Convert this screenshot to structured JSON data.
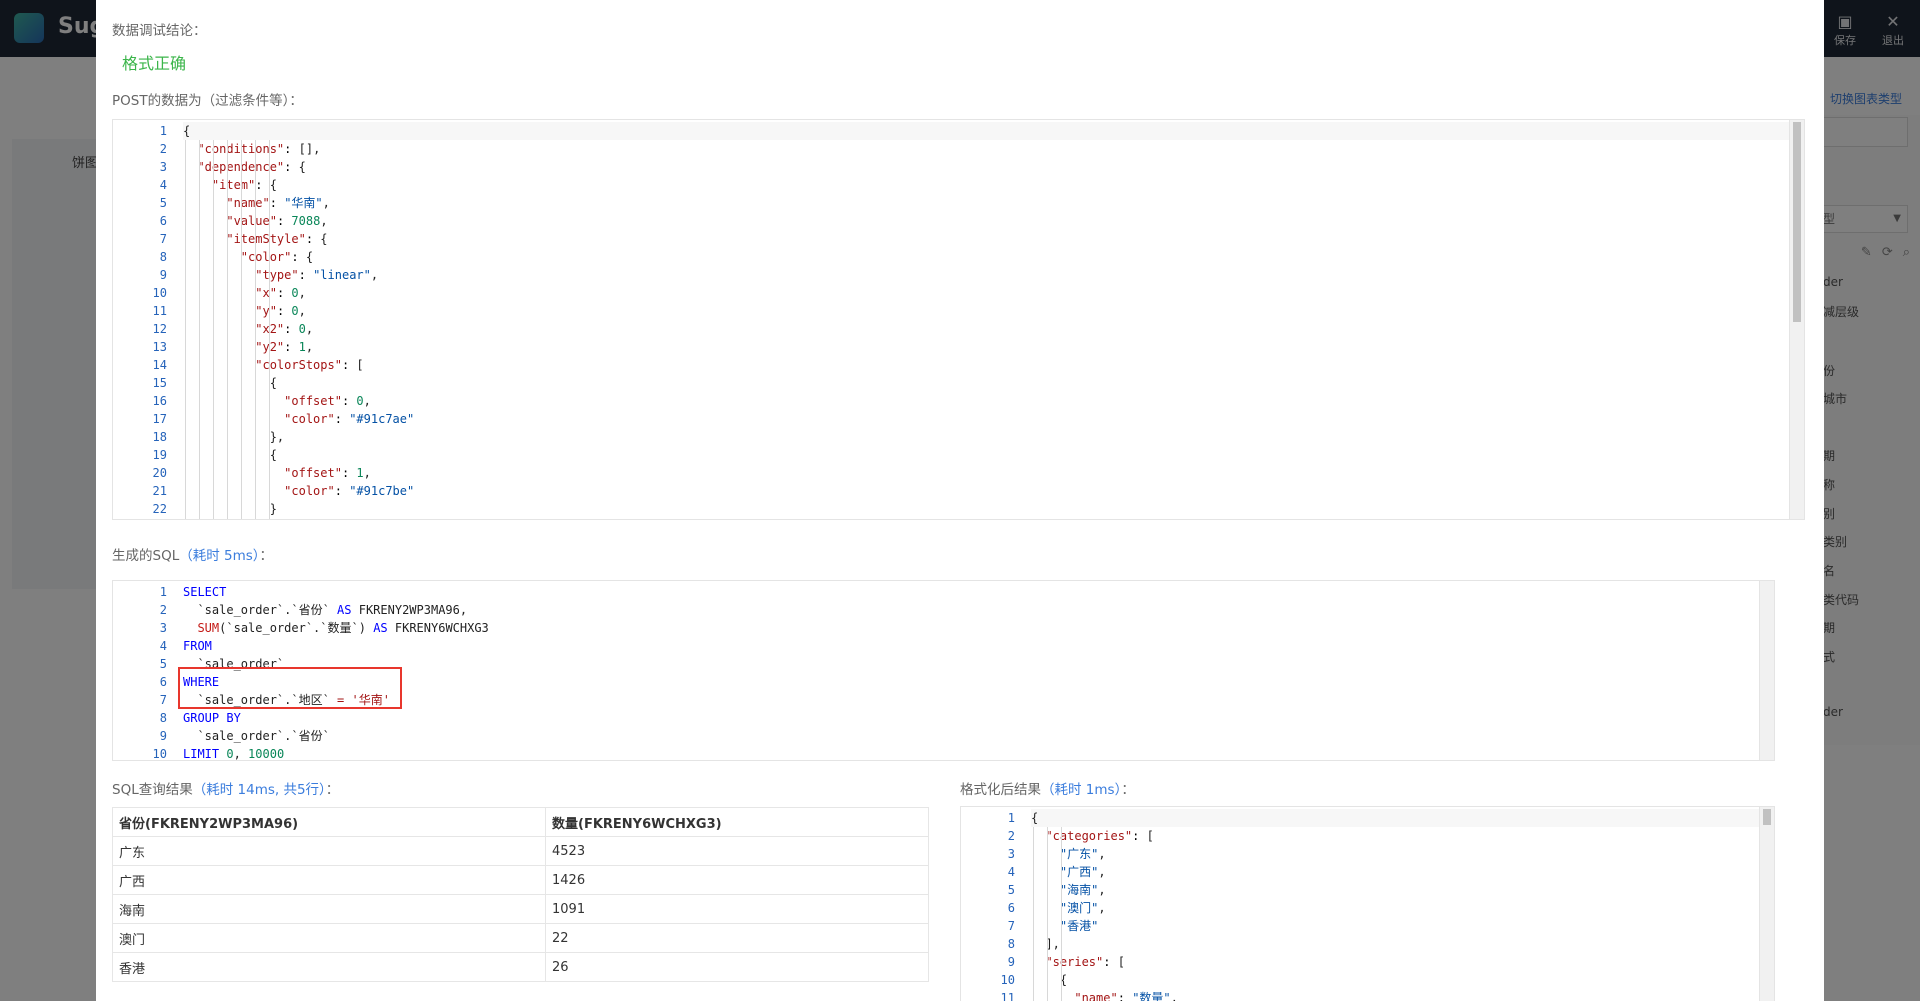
{
  "app": {
    "brand": "Sug",
    "top_actions": [
      {
        "label": "保存",
        "icon": "save-icon"
      },
      {
        "label": "退出",
        "icon": "close-icon"
      }
    ],
    "switch_chart_type": "切换图表类型",
    "left_panel_label": "饼图",
    "right_select_label": "型",
    "right_items": [
      "der",
      "减层级",
      "份",
      "城市",
      "期",
      "称",
      "别",
      "类别",
      "名",
      "类代码",
      "期",
      "式",
      "der"
    ]
  },
  "modal": {
    "conclusion_label": "数据调试结论：",
    "conclusion_value": "格式正确",
    "post_label": "POST的数据为（过滤条件等）：",
    "post_lines": [
      "{",
      "  \"conditions\": [],",
      "  \"dependence\": {",
      "    \"item\": {",
      "      \"name\": \"华南\",",
      "      \"value\": 7088,",
      "      \"itemStyle\": {",
      "        \"color\": {",
      "          \"type\": \"linear\",",
      "          \"x\": 0,",
      "          \"y\": 0,",
      "          \"x2\": 0,",
      "          \"y2\": 1,",
      "          \"colorStops\": [",
      "            {",
      "              \"offset\": 0,",
      "              \"color\": \"#91c7ae\"",
      "            },",
      "            {",
      "              \"offset\": 1,",
      "              \"color\": \"#91c7be\"",
      "            }"
    ],
    "sql_label": "生成的SQL",
    "sql_time": "（耗时 5ms）",
    "sql_label_suffix": "：",
    "sql_lines": [
      "SELECT",
      "  `sale_order`.`省份` AS FKRENY2WP3MA96,",
      "  SUM(`sale_order`.`数量`) AS FKRENY6WCHXG3",
      "FROM",
      "  `sale_order`",
      "WHERE",
      "  `sale_order`.`地区` = '华南'",
      "GROUP BY",
      "  `sale_order`.`省份`",
      "LIMIT 0, 10000"
    ],
    "query_label": "SQL查询结果",
    "query_time": "（耗时 14ms, 共5行）",
    "query_label_suffix": "：",
    "table_headers": [
      "省份(FKRENY2WP3MA96)",
      "数量(FKRENY6WCHXG3)"
    ],
    "table_rows": [
      [
        "广东",
        "4523"
      ],
      [
        "广西",
        "1426"
      ],
      [
        "海南",
        "1091"
      ],
      [
        "澳门",
        "22"
      ],
      [
        "香港",
        "26"
      ]
    ],
    "format_label": "格式化后结果",
    "format_time": "（耗时 1ms）",
    "format_label_suffix": "：",
    "format_lines": [
      "{",
      "  \"categories\": [",
      "    \"广东\",",
      "    \"广西\",",
      "    \"海南\",",
      "    \"澳门\",",
      "    \"香港\"",
      "  ],",
      "  \"series\": [",
      "    {",
      "      \"name\": \"数量\","
    ]
  }
}
